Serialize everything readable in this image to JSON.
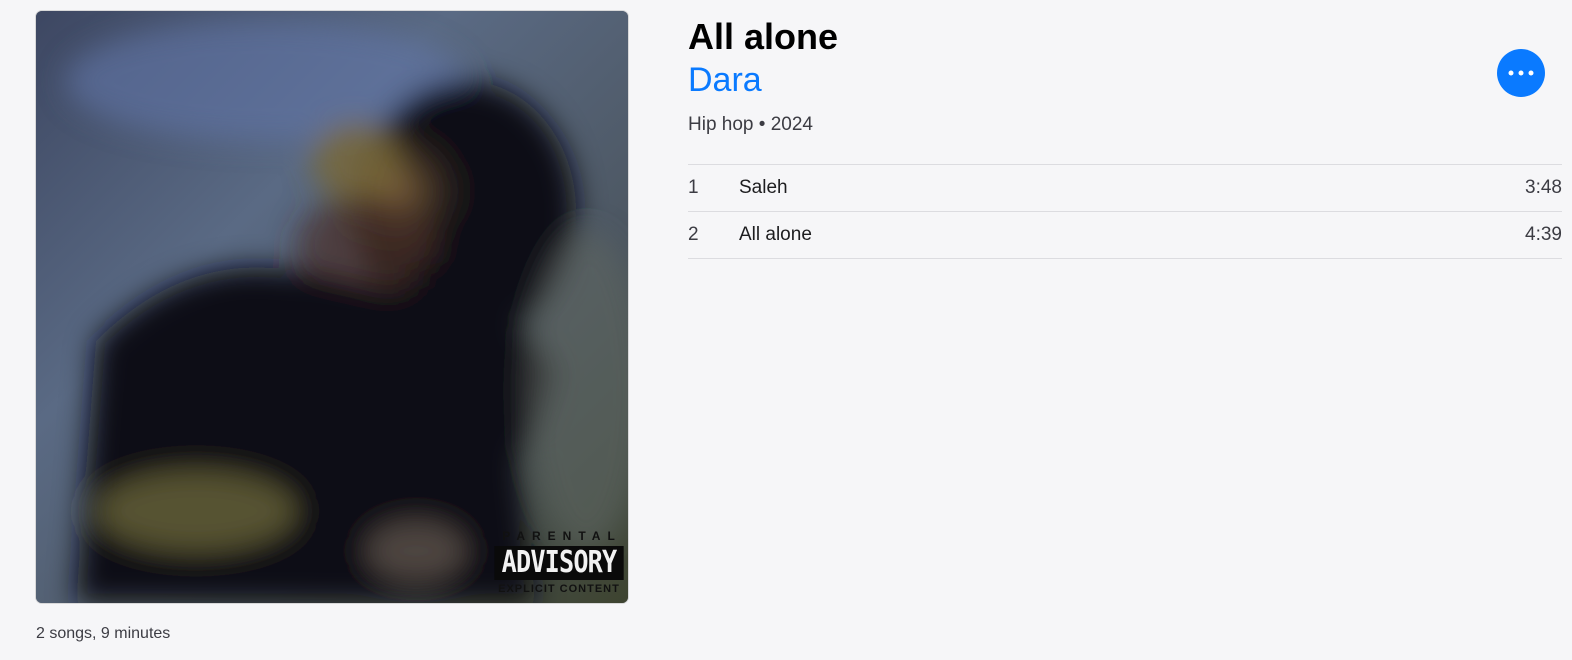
{
  "album": {
    "title": "All alone",
    "artist": "Dara",
    "meta": "Hip hop • 2024",
    "summary": "2 songs, 9 minutes",
    "explicit_label": {
      "top": "PARENTAL",
      "middle": "ADVISORY",
      "bottom": "EXPLICIT CONTENT"
    }
  },
  "more_button": {
    "icon": "ellipsis-icon"
  },
  "tracks": [
    {
      "number": "1",
      "title": "Saleh",
      "duration": "3:48"
    },
    {
      "number": "2",
      "title": "All alone",
      "duration": "4:39"
    }
  ],
  "colors": {
    "accent": "#0a7aff",
    "background": "#f6f6f8"
  }
}
